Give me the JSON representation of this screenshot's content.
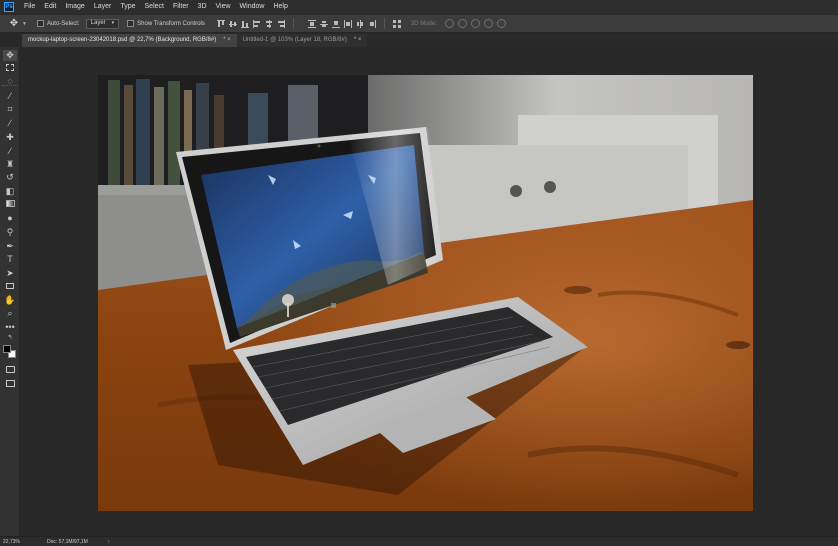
{
  "app": {
    "logo": "Ps",
    "menu": [
      "File",
      "Edit",
      "Image",
      "Layer",
      "Type",
      "Select",
      "Filter",
      "3D",
      "View",
      "Window",
      "Help"
    ]
  },
  "options": {
    "auto_select_label": "Auto-Select:",
    "auto_select_value": "Layer",
    "transform_label": "Show Transform Controls",
    "mode_3d_label": "3D Mode:"
  },
  "tabs": [
    {
      "label": "mockup-laptop-screen-23042018.psd @ 22,7% (Background, RGB/8#)",
      "close": "*  ×"
    },
    {
      "label": "Untitled-1 @ 103% (Layer 18, RGB/8#)",
      "close": "*  ×"
    }
  ],
  "status": {
    "zoom": "22,73%",
    "doc_info": "Doc: 57,1M/97,1M",
    "arrow": "›"
  },
  "icons": {
    "tools": [
      "move-icon",
      "marquee-icon",
      "lasso-icon",
      "magic-wand-icon",
      "crop-icon",
      "eyedropper-icon",
      "healing-brush-icon",
      "brush-icon",
      "clone-stamp-icon",
      "history-brush-icon",
      "eraser-icon",
      "gradient-icon",
      "blur-icon",
      "dodge-icon",
      "pen-icon",
      "type-icon",
      "path-selection-icon",
      "rectangle-icon",
      "hand-icon",
      "zoom-icon",
      "more-tools-icon"
    ]
  },
  "colors": {
    "accent": "#31a8ff",
    "foreground": "#000000",
    "background": "#ffffff"
  }
}
